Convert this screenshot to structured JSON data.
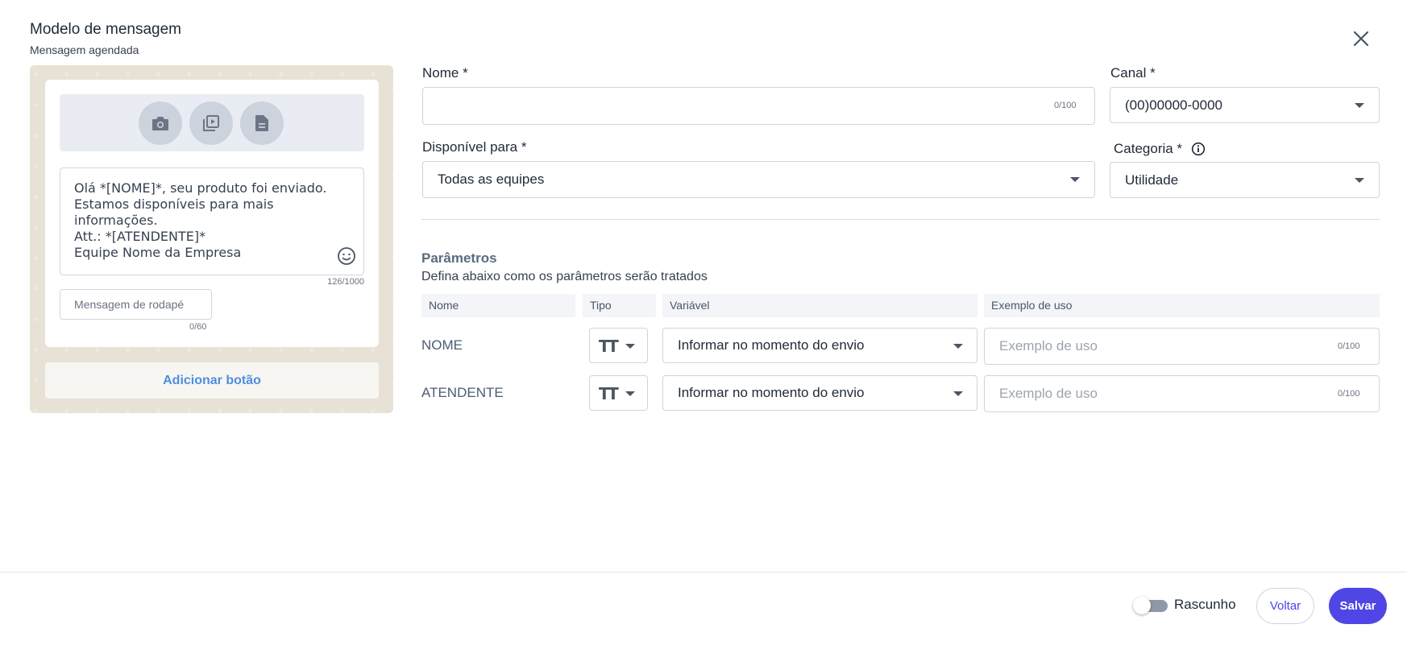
{
  "header": {
    "title": "Modelo de mensagem",
    "subtitle": "Mensagem agendada"
  },
  "preview": {
    "message": "Olá *[NOME]*, seu produto foi enviado.\nEstamos disponíveis para mais\ninformações.\nAtt.: *[ATENDENTE]*\nEquipe Nome da Empresa",
    "message_count": "126/1000",
    "footer_placeholder": "Mensagem de rodapé",
    "footer_count": "0/60",
    "add_button_label": "Adicionar botão"
  },
  "form": {
    "nome_label": "Nome *",
    "nome_value": "",
    "nome_count": "0/100",
    "canal_label": "Canal *",
    "canal_value": "(00)00000-0000",
    "disponivel_label": "Disponível para *",
    "disponivel_value": "Todas as equipes",
    "categoria_label": "Categoria *",
    "categoria_value": "Utilidade"
  },
  "params": {
    "title": "Parâmetros",
    "subtitle": "Defina abaixo como os parâmetros serão tratados",
    "columns": [
      "Nome",
      "Tipo",
      "Variável",
      "Exemplo de uso"
    ],
    "rows": [
      {
        "name": "NOME",
        "type_glyph": "TT",
        "variable": "Informar no momento do envio",
        "example_placeholder": "Exemplo de uso",
        "example_count": "0/100"
      },
      {
        "name": "ATENDENTE",
        "type_glyph": "TT",
        "variable": "Informar no momento do envio",
        "example_placeholder": "Exemplo de uso",
        "example_count": "0/100"
      }
    ]
  },
  "footer": {
    "draft_label": "Rascunho",
    "draft_enabled": false,
    "back_label": "Voltar",
    "save_label": "Salvar"
  },
  "colors": {
    "accent": "#4f46e5",
    "link": "#4f8de0",
    "preview_bg": "#e8e1d6"
  },
  "icons": [
    "close-icon",
    "camera-icon",
    "video-library-icon",
    "document-icon",
    "emoji-icon",
    "info-icon",
    "text-type-icon",
    "caret-down-icon"
  ]
}
